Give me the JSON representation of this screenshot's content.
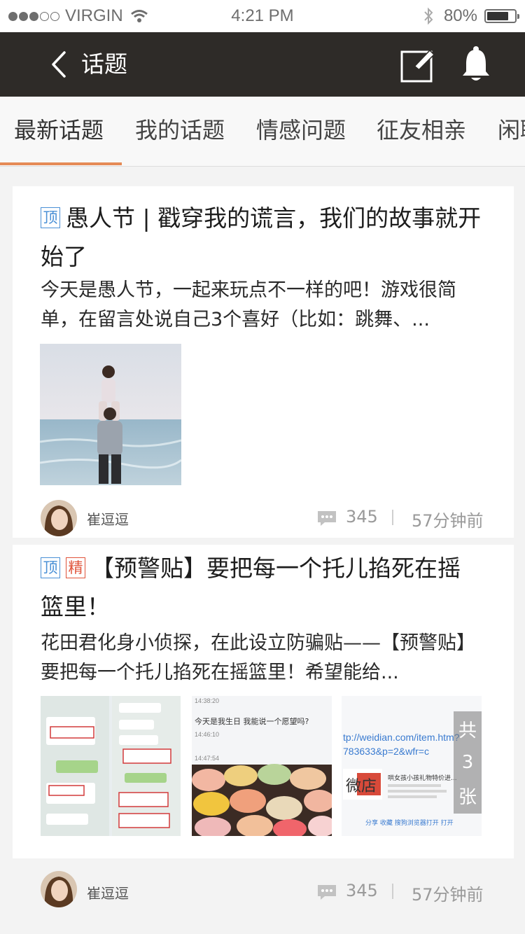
{
  "status_bar": {
    "carrier": "VIRGIN",
    "time": "4:21 PM",
    "battery": "80%",
    "battery_fraction": 0.8,
    "icons": [
      "signal-dots",
      "wifi-icon",
      "bluetooth-icon",
      "battery-icon"
    ]
  },
  "nav": {
    "title": "话题",
    "icons": [
      "back-chevron-icon",
      "compose-icon",
      "bell-icon"
    ]
  },
  "tabs": [
    "最新话题",
    "我的话题",
    "情感问题",
    "征友相亲",
    "闲聊"
  ],
  "accent_color": "#e58a56",
  "posts": [
    {
      "badges": [
        "顶"
      ],
      "title": "愚人节 | 戳穿我的谎言，我们的故事就开始了",
      "summary": "今天是愚人节，一起来玩点不一样的吧！游戏很简单，在留言处说自己3个喜好（比如：跳舞、...",
      "author": "崔逗逗",
      "comments": "345",
      "time": "57分钟前"
    },
    {
      "badges": [
        "顶",
        "精"
      ],
      "title": "【预警贴】要把每一个托儿掐死在摇篮里！",
      "summary": "花田君化身小侦探，在此设立防骗贴——【预警贴】要把每一个托儿掐死在摇篮里！希望能给...",
      "author": "崔逗逗",
      "comments": "345",
      "time": "57分钟前",
      "more_images": [
        "共",
        "3",
        "张"
      ],
      "image_texts": {
        "chat_time1": "14:38:20",
        "chat_line": "今天是我生日 我能说一个愿望吗?",
        "chat_time2": "14:46:10",
        "chat_time3": "14:47:54",
        "url_line1": "tp://weidian.com/item.htm?",
        "url_line2": "783633&p=2&wfr=c",
        "shop_tag": "微店",
        "product": "哄女孩小孩礼物特价进...",
        "actions": "分享  收藏  搜狗浏览器打开  打开"
      }
    }
  ]
}
